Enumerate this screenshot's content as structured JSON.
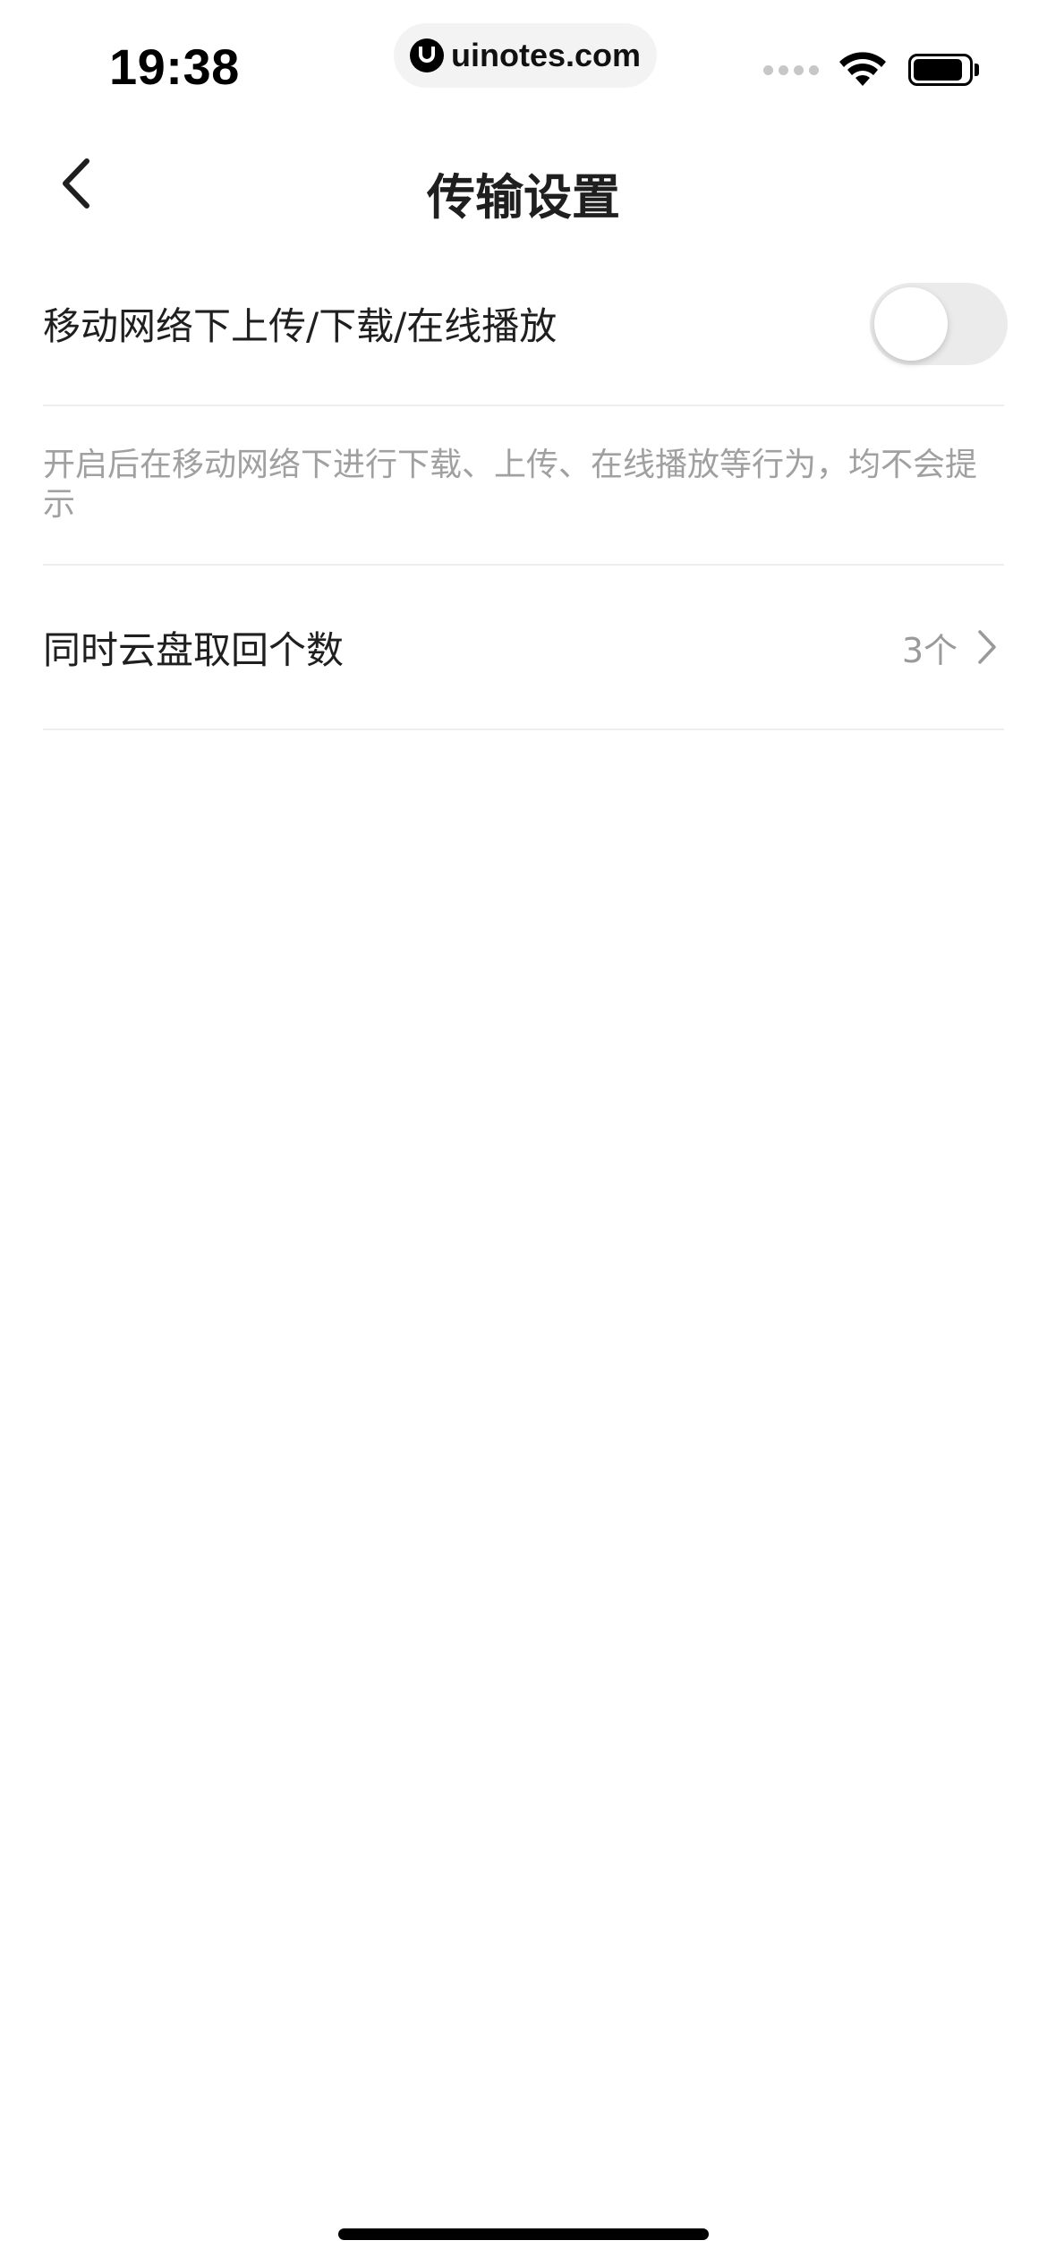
{
  "status_bar": {
    "time": "19:38",
    "url": "uinotes.com",
    "icons": [
      "signal-icon",
      "wifi-icon",
      "battery-icon"
    ]
  },
  "nav": {
    "title": "传输设置",
    "back_icon": "chevron-left-icon"
  },
  "settings": {
    "mobile_network": {
      "label": "移动网络下上传/下载/在线播放",
      "enabled": false,
      "description": "开启后在移动网络下进行下载、上传、在线播放等行为，均不会提示"
    },
    "concurrent_retrieval": {
      "label": "同时云盘取回个数",
      "value": "3个",
      "icon": "chevron-right-icon"
    }
  },
  "colors": {
    "background": "#ffffff",
    "primary_text": "#1f1f1f",
    "secondary_text": "#a0a0a0",
    "divider": "#eeeeee",
    "toggle_off": "#ebebeb"
  }
}
